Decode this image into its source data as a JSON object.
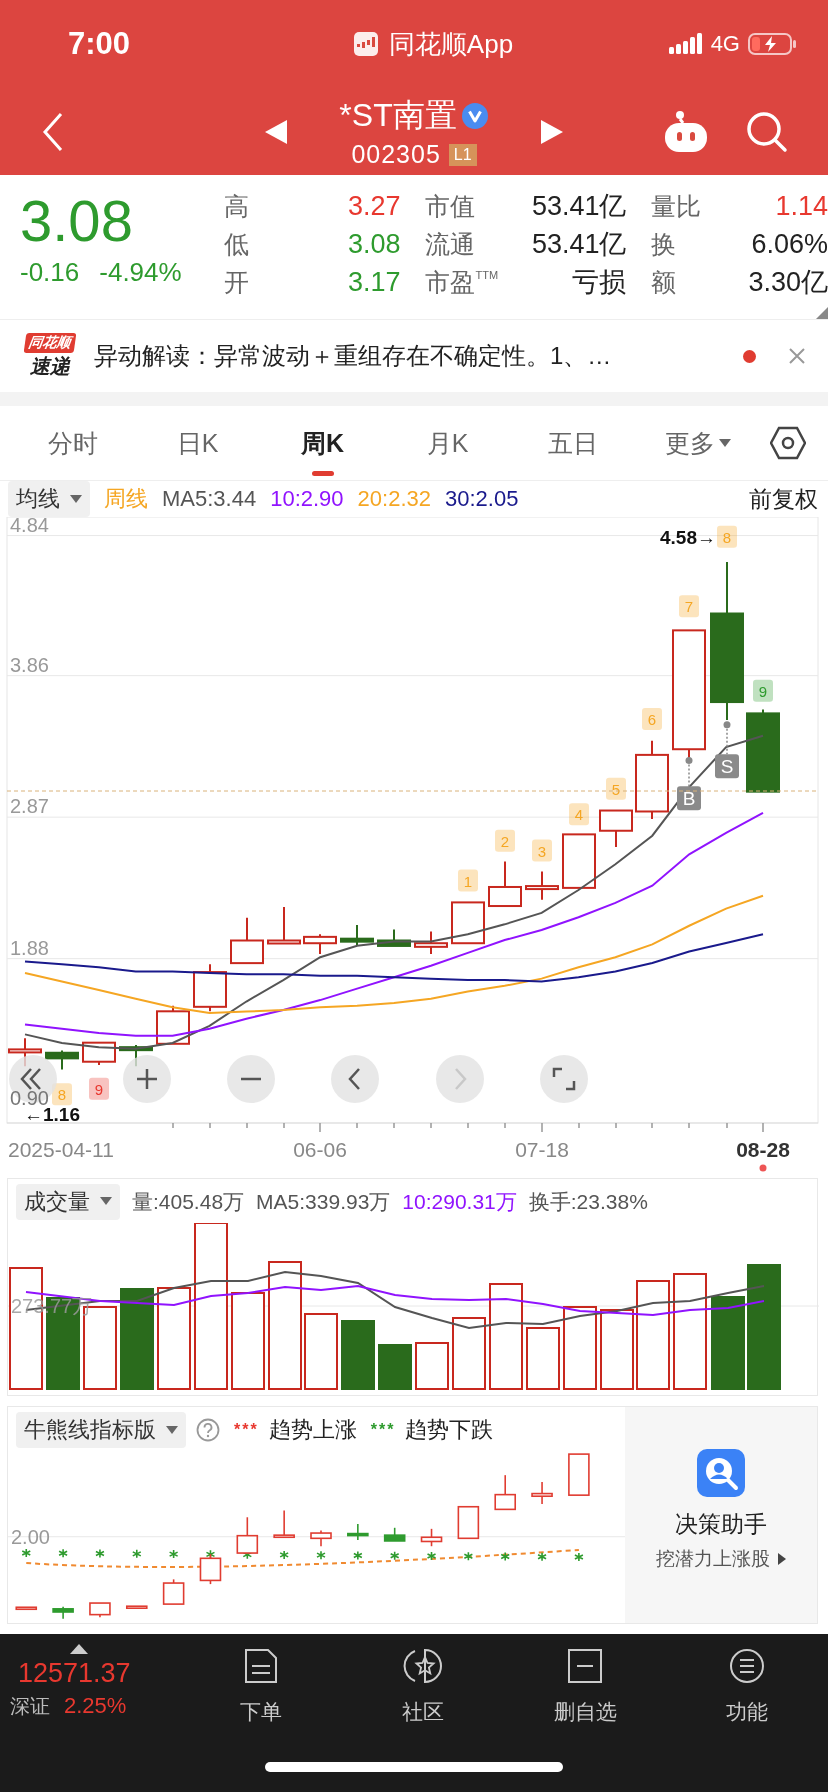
{
  "status_bar": {
    "time": "7:00",
    "app": "同花顺App",
    "network": "4G"
  },
  "header": {
    "title": "*ST南置",
    "verified": true,
    "code": "002305",
    "badge": "L1"
  },
  "quote": {
    "price": "3.08",
    "change": "-0.16",
    "change_pct": "-4.94%",
    "color": "#2e9b2e",
    "columns": [
      {
        "items": [
          {
            "label": "高",
            "value": "3.27",
            "color": "#e8382f"
          },
          {
            "label": "低",
            "value": "3.08",
            "color": "#2e9b2e"
          },
          {
            "label": "开",
            "value": "3.17",
            "color": "#2e9b2e"
          }
        ]
      },
      {
        "items": [
          {
            "label": "市值",
            "value": "53.41亿",
            "color": "#222222"
          },
          {
            "label": "流通",
            "value": "53.41亿",
            "color": "#222222"
          },
          {
            "label": "市盈$^{TTM}$",
            "value": "亏损",
            "color": "#222222"
          }
        ]
      },
      {
        "items": [
          {
            "label": "量比",
            "value": "1.14",
            "color": "#e8382f"
          },
          {
            "label": "换",
            "value": "6.06%",
            "color": "#222222"
          },
          {
            "label": "额",
            "value": "3.30亿",
            "color": "#222222"
          }
        ]
      }
    ]
  },
  "news": {
    "source_top": "同花顺",
    "source_bottom": "速递",
    "text": "异动解读：异常波动＋重组存在不确定性。1、…",
    "unread": true
  },
  "tabs": [
    {
      "label": "分时",
      "selected": false,
      "kind": "tab"
    },
    {
      "label": "日K",
      "selected": false,
      "kind": "tab"
    },
    {
      "label": "周K",
      "selected": true,
      "kind": "tab"
    },
    {
      "label": "月K",
      "selected": false,
      "kind": "tab"
    },
    {
      "label": "五日",
      "selected": false,
      "kind": "tab"
    },
    {
      "label": "更多",
      "selected": false,
      "kind": "menu"
    }
  ],
  "ma_bar": {
    "selector": "均线",
    "items": [
      {
        "text": "周线",
        "color": "#f5a623"
      },
      {
        "text": "MA5:3.44",
        "color": "#555555"
      },
      {
        "text": "10:2.90",
        "color": "#9013fe"
      },
      {
        "text": "20:2.32",
        "color": "#f5a623"
      },
      {
        "text": "30:2.05",
        "color": "#1a1a8c"
      }
    ],
    "adjust": "前复权"
  },
  "price_chart": {
    "high_label": "4.58→",
    "low_label": "←1.16",
    "chart_data": {
      "type": "line",
      "ylim": [
        0.73,
        4.97
      ],
      "grid": true,
      "yticks": [
        {
          "value": 4.84,
          "label": "4.84"
        },
        {
          "value": 3.86,
          "label": "3.86"
        },
        {
          "value": 2.87,
          "label": "2.87"
        },
        {
          "value": 1.88,
          "label": "1.88"
        },
        {
          "value": 0.9,
          "label": "0.90"
        }
      ],
      "series": [
        {
          "color": "#555555",
          "values": [
            1.35,
            1.29,
            1.26,
            1.25,
            1.29,
            1.41,
            1.58,
            1.73,
            1.89,
            1.97,
            2.0,
            2.0,
            2.05,
            2.12,
            2.2,
            2.36,
            2.54,
            2.74,
            3.08,
            3.36,
            3.44
          ]
        },
        {
          "color": "#9013fe",
          "values": [
            1.42,
            1.39,
            1.36,
            1.34,
            1.34,
            1.39,
            1.46,
            1.52,
            1.59,
            1.67,
            1.75,
            1.83,
            1.92,
            2.01,
            2.08,
            2.17,
            2.27,
            2.39,
            2.61,
            2.76,
            2.9
          ]
        },
        {
          "color": "#f5a623",
          "values": [
            1.78,
            1.72,
            1.66,
            1.6,
            1.54,
            1.5,
            1.51,
            1.52,
            1.54,
            1.55,
            1.57,
            1.6,
            1.65,
            1.69,
            1.74,
            1.82,
            1.89,
            1.98,
            2.11,
            2.23,
            2.32
          ]
        },
        {
          "color": "#1a1a8c",
          "values": [
            1.86,
            1.84,
            1.82,
            1.79,
            1.79,
            1.78,
            1.77,
            1.77,
            1.76,
            1.76,
            1.75,
            1.74,
            1.73,
            1.73,
            1.72,
            1.75,
            1.79,
            1.85,
            1.93,
            1.99,
            2.05
          ]
        }
      ]
    },
    "tags": [
      {
        "text": "8",
        "color": "#f5a623"
      },
      {
        "text": "9",
        "color": "#e8382f"
      },
      {
        "text": "1",
        "color": "#f5a623"
      },
      {
        "text": "2",
        "color": "#f5a623"
      },
      {
        "text": "3",
        "color": "#f5a623"
      },
      {
        "text": "4",
        "color": "#f5a623"
      },
      {
        "text": "5",
        "color": "#f5a623"
      },
      {
        "text": "6",
        "color": "#f5a623"
      },
      {
        "text": "7",
        "color": "#f5a623"
      },
      {
        "text": "8",
        "color": "#f5a623"
      },
      {
        "text": "9",
        "color": "#2e9b2e"
      }
    ],
    "signals": [
      {
        "text": "B"
      },
      {
        "text": "S"
      }
    ],
    "dates": [
      {
        "text": "2025-04-11",
        "current": false
      },
      {
        "text": "06-06",
        "current": false
      },
      {
        "text": "07-18",
        "current": false
      },
      {
        "text": "08-28",
        "current": true
      }
    ]
  },
  "controls": [
    {
      "kind": "rewind",
      "disabled": false
    },
    {
      "kind": "zoom_in",
      "disabled": false
    },
    {
      "kind": "zoom_out",
      "disabled": false
    },
    {
      "kind": "prev",
      "disabled": false
    },
    {
      "kind": "next",
      "disabled": true
    },
    {
      "kind": "fullscreen",
      "disabled": false
    }
  ],
  "volume": {
    "selector": "成交量",
    "items": [
      {
        "text": "量:405.48万",
        "color": "#555555"
      },
      {
        "text": "MA5:339.93万",
        "color": "#555555"
      },
      {
        "text": "10:290.31万",
        "color": "#9013fe"
      },
      {
        "text": "换手:23.38%",
        "color": "#555555"
      }
    ],
    "axis_label": "273.77万"
  },
  "indicator": {
    "selector": "牛熊线指标版",
    "legend": [
      {
        "marks": "***",
        "text": "趋势上涨",
        "color": "#e8382f"
      },
      {
        "marks": "***",
        "text": "趋势下跌",
        "color": "#2e9b2e"
      }
    ],
    "axis_label": "2.00",
    "promo": {
      "title": "决策助手",
      "subtitle": "挖潜力上涨股"
    }
  },
  "bottom_bar": {
    "index": {
      "value": "12571.37",
      "name": "深证",
      "change": "2.25%",
      "color": "#e8382f"
    },
    "items": [
      {
        "label": "下单",
        "kind": "order"
      },
      {
        "label": "社区",
        "kind": "community"
      },
      {
        "label": "删自选",
        "kind": "remove"
      },
      {
        "label": "功能",
        "kind": "menu"
      }
    ]
  }
}
